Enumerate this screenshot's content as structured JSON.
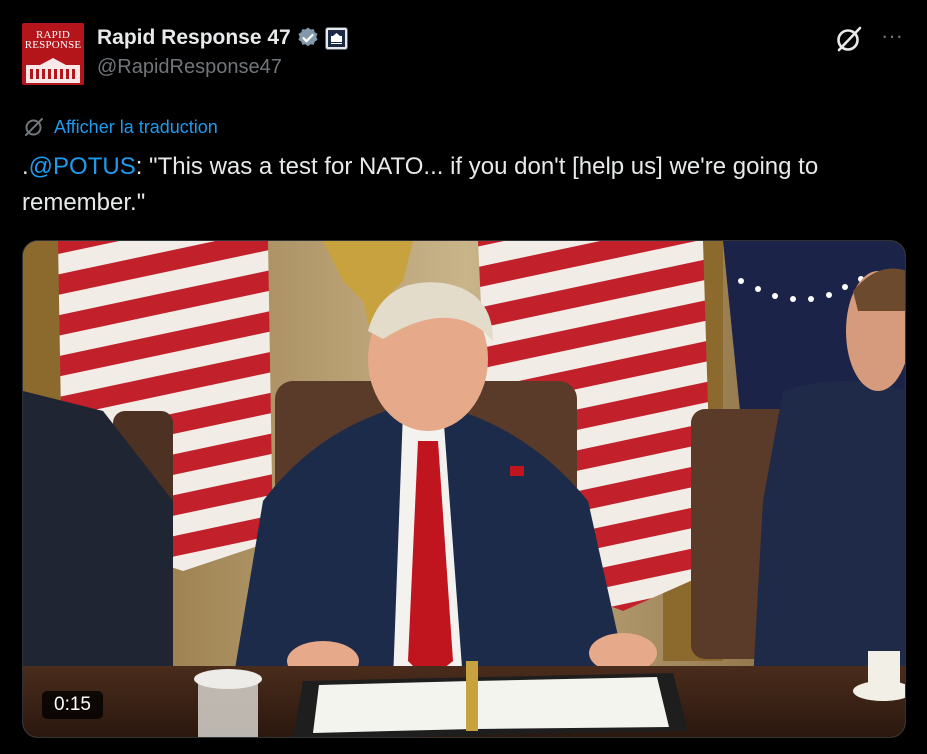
{
  "author": {
    "display_name": "Rapid Response 47",
    "handle": "@RapidResponse47",
    "avatar_text": "RAPID RESPONSE",
    "affiliation_badge_text": "THE WHITE HOUSE",
    "verified_icon": "verified-badge-icon"
  },
  "actions": {
    "grok_icon": "grok-icon",
    "more_label": "···"
  },
  "translation": {
    "label": "Afficher la traduction",
    "icon": "grok-icon"
  },
  "tweet": {
    "prefix": ".",
    "mention": "@POTUS",
    "text": ": \"This was a test for NATO... if you don't [help us] we're going to remember.\""
  },
  "media": {
    "type": "video",
    "duration": "0:15"
  },
  "colors": {
    "background": "#000000",
    "text": "#e7e9ea",
    "secondary": "#71767b",
    "link": "#1d9bf0",
    "verified": "#829aab",
    "avatar": "#b3151b"
  }
}
